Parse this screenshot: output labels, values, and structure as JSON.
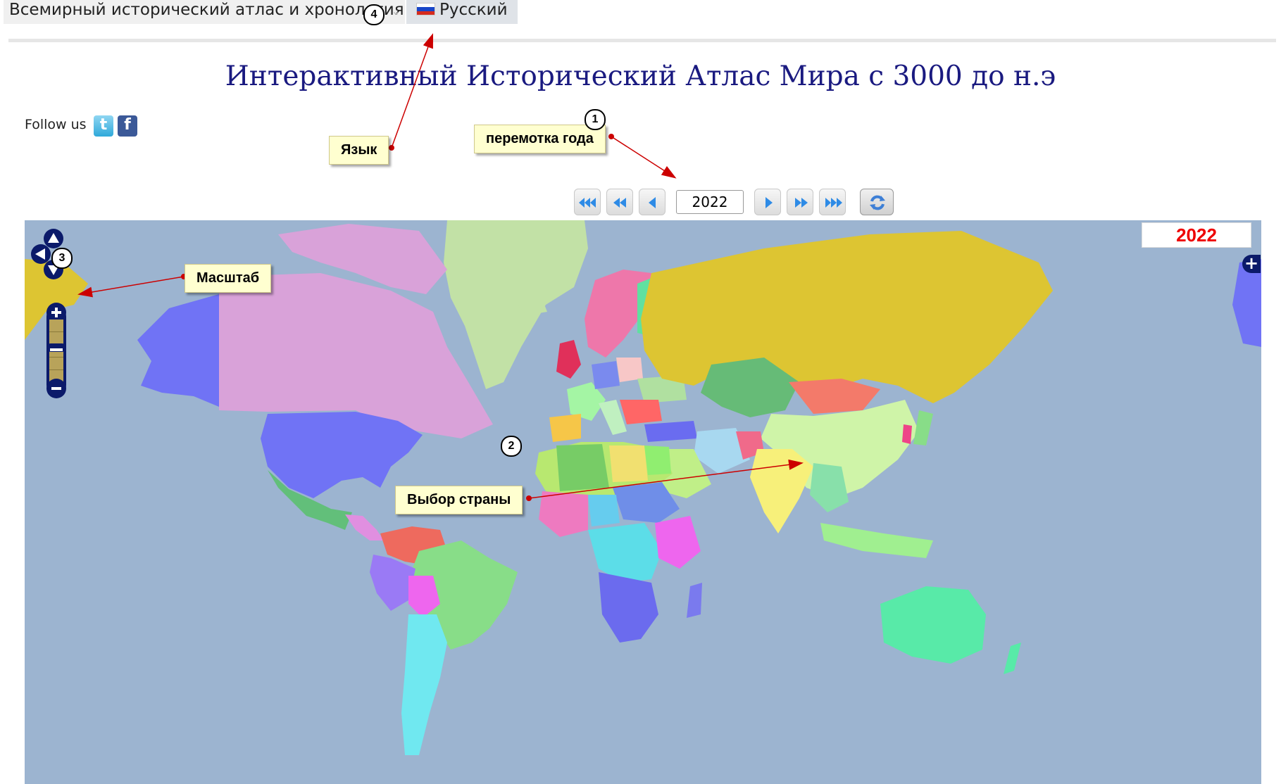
{
  "topbar": {
    "site_menu_label": "Всемирный исторический атлас и хронология",
    "language_label": "Русский"
  },
  "page_title": "Интерактивный Исторический Атлас Мира с 3000 до н.э",
  "follow_label": "Follow us",
  "controls": {
    "year_value": "2022"
  },
  "map": {
    "year_display": "2022"
  },
  "annotations": {
    "rewind_year": "перемотка года",
    "language": "Язык",
    "scale": "Масштаб",
    "country_select": "Выбор страны",
    "badge_1": "1",
    "badge_2": "2",
    "badge_3": "3",
    "badge_4": "4"
  },
  "colors": {
    "ocean": "#9cb4d0",
    "control_dark_blue": "#0b1a6a",
    "year_red": "#ee0000",
    "title_blue": "#1a1a80",
    "arrow_red": "#cc0000"
  }
}
